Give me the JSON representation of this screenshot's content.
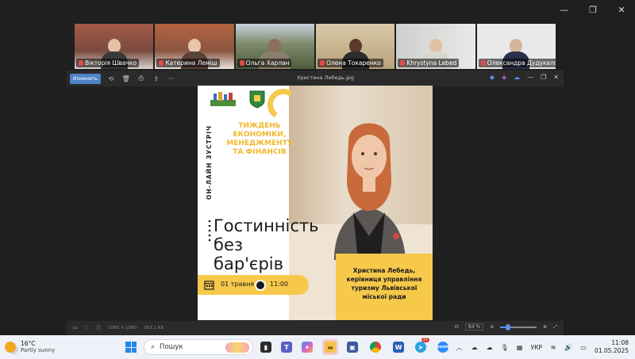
{
  "participants": [
    {
      "name": "Вікторія Швачко",
      "bg": "#8a5a4a"
    },
    {
      "name": "Катерина Леміш",
      "bg": "#9a6a55"
    },
    {
      "name": "Ольга Харлан",
      "bg": "#6a7c58"
    },
    {
      "name": "Олена Токаренко",
      "bg": "#c9b89a"
    },
    {
      "name": "Khrystyna Lebed",
      "bg": "#d8d8d6"
    },
    {
      "name": "Олександра Дудукало...",
      "bg": "#e8e8ea"
    }
  ],
  "viewer": {
    "edit_label": "Изменить",
    "file_name": "Христина Лебедь.jpg",
    "dimensions": "1080 × 1080",
    "file_size": "163,1 КБ",
    "zoom": "84 %",
    "zoom_level": 0.84
  },
  "poster": {
    "vertical_text": "ОН-ЛАЙН ЗУСТРІЧ",
    "event_title": "ТИЖДЕНЬ ЕКОНОМІКИ, МЕНЕДЖМЕНТУ ТА ФІНАНСІВ",
    "headline_line1": "Гостинність",
    "headline_line2": "без",
    "headline_line3": "бар'єрів",
    "date": "01 травня",
    "time": "11:00",
    "speaker": "Христина Лебедь, керівниця управління туризму Львівської міської ради"
  },
  "taskbar": {
    "weather_temp": "16°C",
    "weather_desc": "Partly sunny",
    "search_label": "Пошук",
    "language": "УКР",
    "time": "11:08",
    "date": "01.05.2025",
    "teams_badge": "37"
  },
  "colors": {
    "accent_yellow": "#f6c94b",
    "title_yellow": "#f2b82a",
    "active_speaker": "#3fd05a"
  }
}
